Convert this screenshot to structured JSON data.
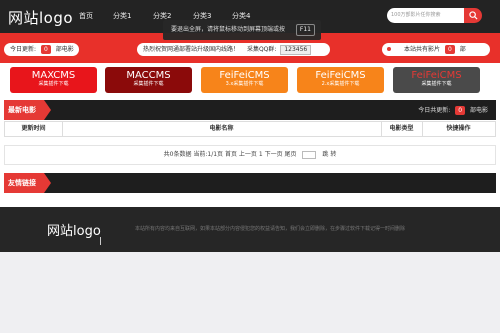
{
  "header": {
    "logo": "网站logo",
    "nav": [
      "首页",
      "分类1",
      "分类2",
      "分类3",
      "分类4"
    ],
    "search_placeholder": "100万部影片任你搜索",
    "fullscreen_tip": "要退出全屏，请将鼠标移动到屏幕顶端或按",
    "fullscreen_key": "F11"
  },
  "stats": {
    "today_label": "今日更新:",
    "today_count": "0",
    "today_unit": "部电影",
    "notice": "热烈祝贺网通部署站升级国内线路！",
    "qq_label": "采集QQ群:",
    "qq_value": "123456",
    "total_label": "本站共有影片",
    "total_count": "0",
    "total_unit": "部"
  },
  "banners": [
    {
      "title": "MAXCMS",
      "sub": "采集插件下载",
      "color": "#e8151b"
    },
    {
      "title": "MACCMS",
      "sub": "采集插件下载",
      "color": "#8b0a0a"
    },
    {
      "title": "FeiFeiCMS",
      "sub": "3.x采集插件下载",
      "color": "#f7841a"
    },
    {
      "title": "FeiFeiCMS",
      "sub": "2.x采集插件下载",
      "color": "#f7841a"
    },
    {
      "title": "FeiFeiCMS",
      "sub": "采集插件下载",
      "color": "#4a4a4a"
    }
  ],
  "latest": {
    "title": "最新电影",
    "today_label": "今日共更新:",
    "today_count": "0",
    "today_unit": "部电影",
    "columns": [
      "更新时间",
      "电影名称",
      "电影类型",
      "快捷操作"
    ],
    "pager": {
      "summary": "共0条数据 当前:1/1页",
      "first": "首页",
      "prev": "上一页",
      "page": "1",
      "next": "下一页",
      "last": "尾页",
      "jump": "跳 转"
    }
  },
  "links": {
    "title": "友情链接"
  },
  "footer": {
    "logo": "网站logo",
    "text": "本站所有内容均来自互联网，如果本站部分内容侵犯您的权益请告知，我们会立即删除，在步骤过软件下载记得一时间删除"
  }
}
